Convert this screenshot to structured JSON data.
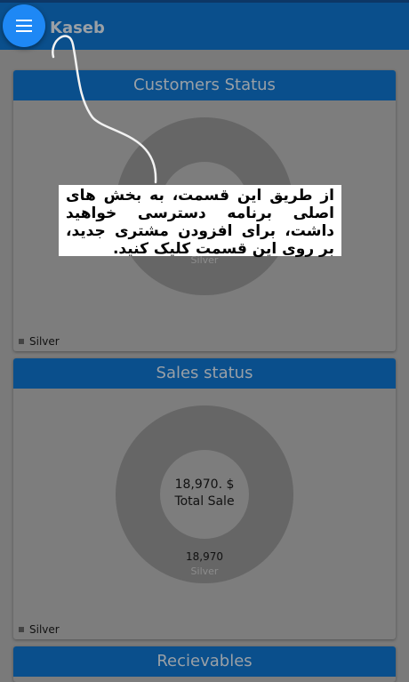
{
  "app": {
    "title": "Kaseb",
    "menu_icon": "hamburger-menu-icon"
  },
  "cards": {
    "customers": {
      "title": "Customers Status",
      "slice_label": "Silver",
      "legend_label": "Silver"
    },
    "sales": {
      "title": "Sales status",
      "total_value": "18,970. $",
      "total_label": "Total Sale",
      "slice_value": "18,970",
      "slice_label": "Silver",
      "legend_label": "Silver"
    },
    "receivables": {
      "title": "Recievables"
    }
  },
  "tutorial": {
    "text": "از طریق این قسمت، به بخش های اصلی برنامه دسترسی خواهید داشت، برای افزودن مشتری جدید، بر روی این قسمت کلیک کنید."
  },
  "colors": {
    "primary": "#0a4f8c",
    "fab": "#1e88f5",
    "overlay": "#7a7a7a",
    "donut": "#666666"
  }
}
